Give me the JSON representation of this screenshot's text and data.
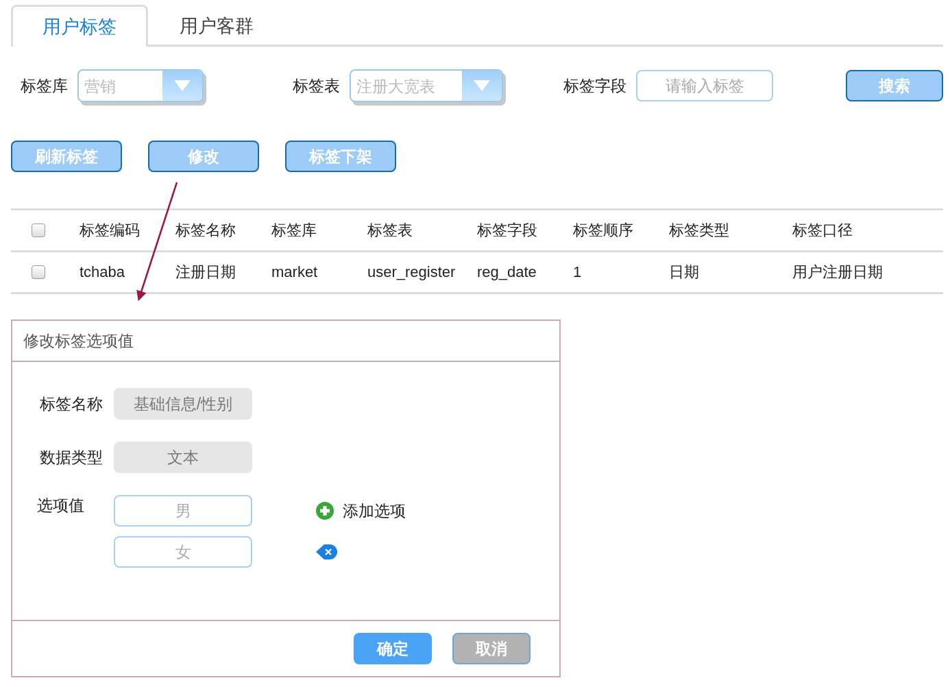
{
  "tabs": [
    {
      "label": "用户标签",
      "selected": true
    },
    {
      "label": "用户客群",
      "selected": false
    }
  ],
  "filters": {
    "library": {
      "label": "标签库",
      "value": "营销"
    },
    "table": {
      "label": "标签表",
      "value": "注册大宽表"
    },
    "field": {
      "label": "标签字段",
      "placeholder": "请输入标签"
    },
    "search_button": "搜索"
  },
  "actions": [
    "刷新标签",
    "修改",
    "标签下架"
  ],
  "table": {
    "header_checked": false,
    "columns": [
      "标签编码",
      "标签名称",
      "标签库",
      "标签表",
      "标签字段",
      "标签顺序",
      "标签类型",
      "标签口径"
    ],
    "rows": [
      {
        "checked": false,
        "cells": [
          "tchaba",
          "注册日期",
          "market",
          "user_register",
          "reg_date",
          "1",
          "日期",
          "用户注册日期"
        ]
      }
    ]
  },
  "dialog": {
    "title": "修改标签选项值",
    "fields": [
      {
        "label": "标签名称",
        "value": "基础信息/性别"
      },
      {
        "label": "数据类型",
        "value": "文本"
      }
    ],
    "options_label": "选项值",
    "options": [
      {
        "value": "男",
        "kind": "add",
        "action_label": "添加选项"
      },
      {
        "value": "女",
        "kind": "remove"
      }
    ],
    "buttons": [
      {
        "label": "确定",
        "kind": "primary"
      },
      {
        "label": "取消",
        "kind": "secondary"
      }
    ]
  }
}
